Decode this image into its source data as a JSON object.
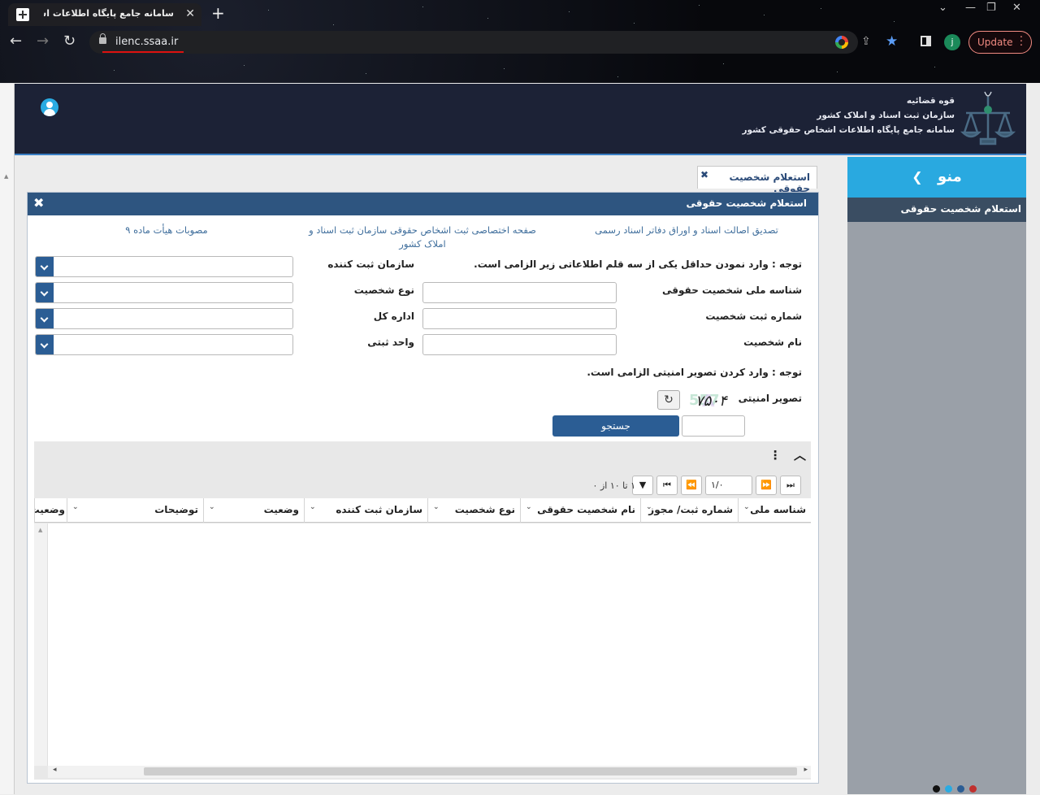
{
  "browser": {
    "tab_title": "سامانه جامع پایگاه اطلاعات اشخاص حقوقی",
    "url": "ilenc.ssaa.ir",
    "update_label": "Update",
    "profile_initial": "j"
  },
  "header": {
    "line1": "قوه قضائیه",
    "line2": "سازمان ثبت اسناد و املاک کشور",
    "line3": "سامانه جامع پایگاه اطلاعات اشخاص حقوقی کشور"
  },
  "menu": {
    "title": "منو",
    "items": [
      {
        "label": "استعلام شخصیت حقوقی"
      }
    ]
  },
  "work_tab": {
    "label": "استعلام شخصیت حقوقی"
  },
  "panel": {
    "title": "استعلام شخصیت حقوقی",
    "links": [
      "تصدیق اصالت اسناد و اوراق دفاتر اسناد رسمی",
      "صفحه اختصاصی ثبت اشخاص حقوقی سازمان ثبت اسناد و املاک کشور",
      "مصوبات هیأت ماده ۹"
    ],
    "note1": "توجه : وارد نمودن حداقل یکی از سه قلم اطلاعاتی زیر الزامی است.",
    "fields": {
      "national_id": "شناسه ملی شخصیت حقوقی",
      "reg_number": "شماره ثبت شخصیت",
      "name": "نام شخصیت",
      "reg_org": "سازمان ثبت کننده",
      "type": "نوع شخصیت",
      "general_office": "اداره کل",
      "reg_unit": "واحد ثبتی"
    },
    "note2": "توجه : وارد کردن تصویر امنیتی الزامی است.",
    "captcha_label": "تصویر امنیتی",
    "captcha_text": "۷۵۰۴",
    "search_label": "جستجو"
  },
  "grid": {
    "page_value": "۱/۰",
    "range_text": "۱ تا ۱۰ از ۰",
    "columns": [
      "شناسه ملی",
      "شماره ثبت/ مجوز",
      "نام شخصیت حقوقی",
      "نوع شخصیت",
      "سازمان ثبت کننده",
      "وضعیت",
      "توضیحات",
      "وضعیت"
    ]
  },
  "colors": {
    "panel_head": "#2e5580",
    "accent_blue": "#29a9e0",
    "button_blue": "#2b5d94"
  }
}
